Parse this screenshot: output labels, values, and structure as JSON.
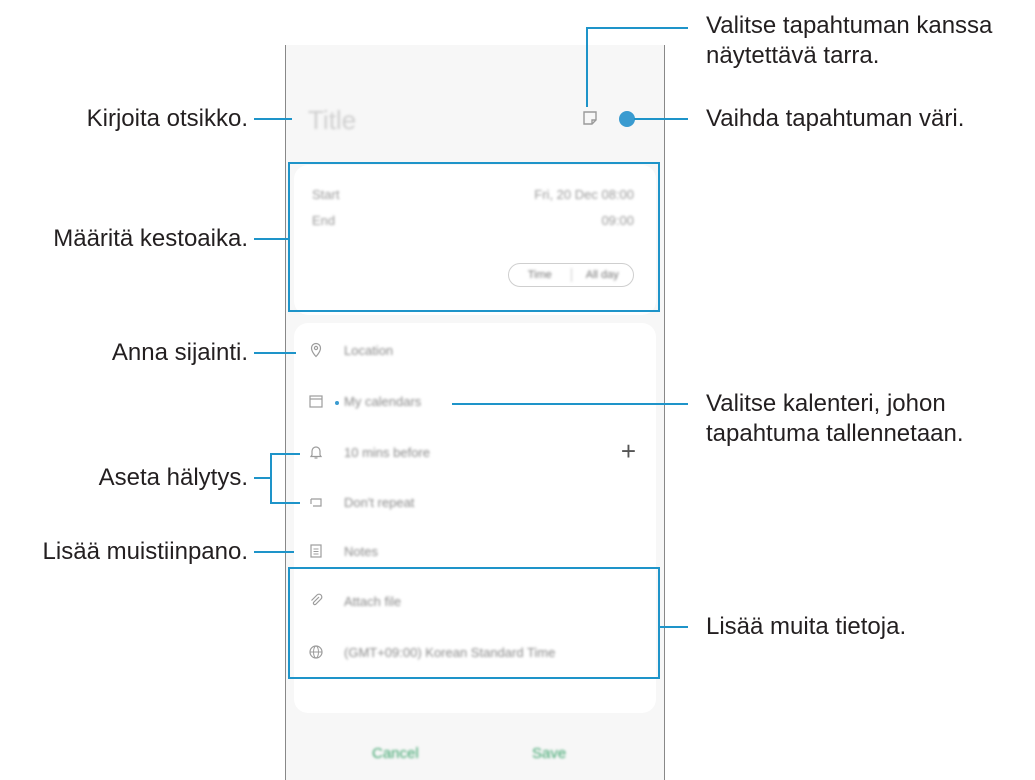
{
  "phone": {
    "title_placeholder": "Title",
    "start_label": "Start",
    "start_value": "Fri, 20 Dec  08:00",
    "end_label": "End",
    "end_value": "09:00",
    "toggle_time": "Time",
    "toggle_allday": "All day",
    "location": "Location",
    "calendar": "My calendars",
    "alarm": "10 mins before",
    "repeat": "Don't repeat",
    "notes": "Notes",
    "attach": "Attach file",
    "timezone": "(GMT+09:00) Korean Standard Time",
    "cancel": "Cancel",
    "save": "Save",
    "event_color": "#3a9bd0"
  },
  "callouts": {
    "title": "Kirjoita otsikko.",
    "sticker_line1": "Valitse tapahtuman kanssa",
    "sticker_line2": "näytettävä tarra.",
    "color": "Vaihda tapahtuman väri.",
    "duration": "Määritä kestoaika.",
    "location": "Anna sijainti.",
    "calendar_line1": "Valitse kalenteri, johon",
    "calendar_line2": "tapahtuma tallennetaan.",
    "alarm": "Aseta hälytys.",
    "notes": "Lisää muistiinpano.",
    "more": "Lisää muita tietoja."
  },
  "highlight_color": "#1e94c9"
}
